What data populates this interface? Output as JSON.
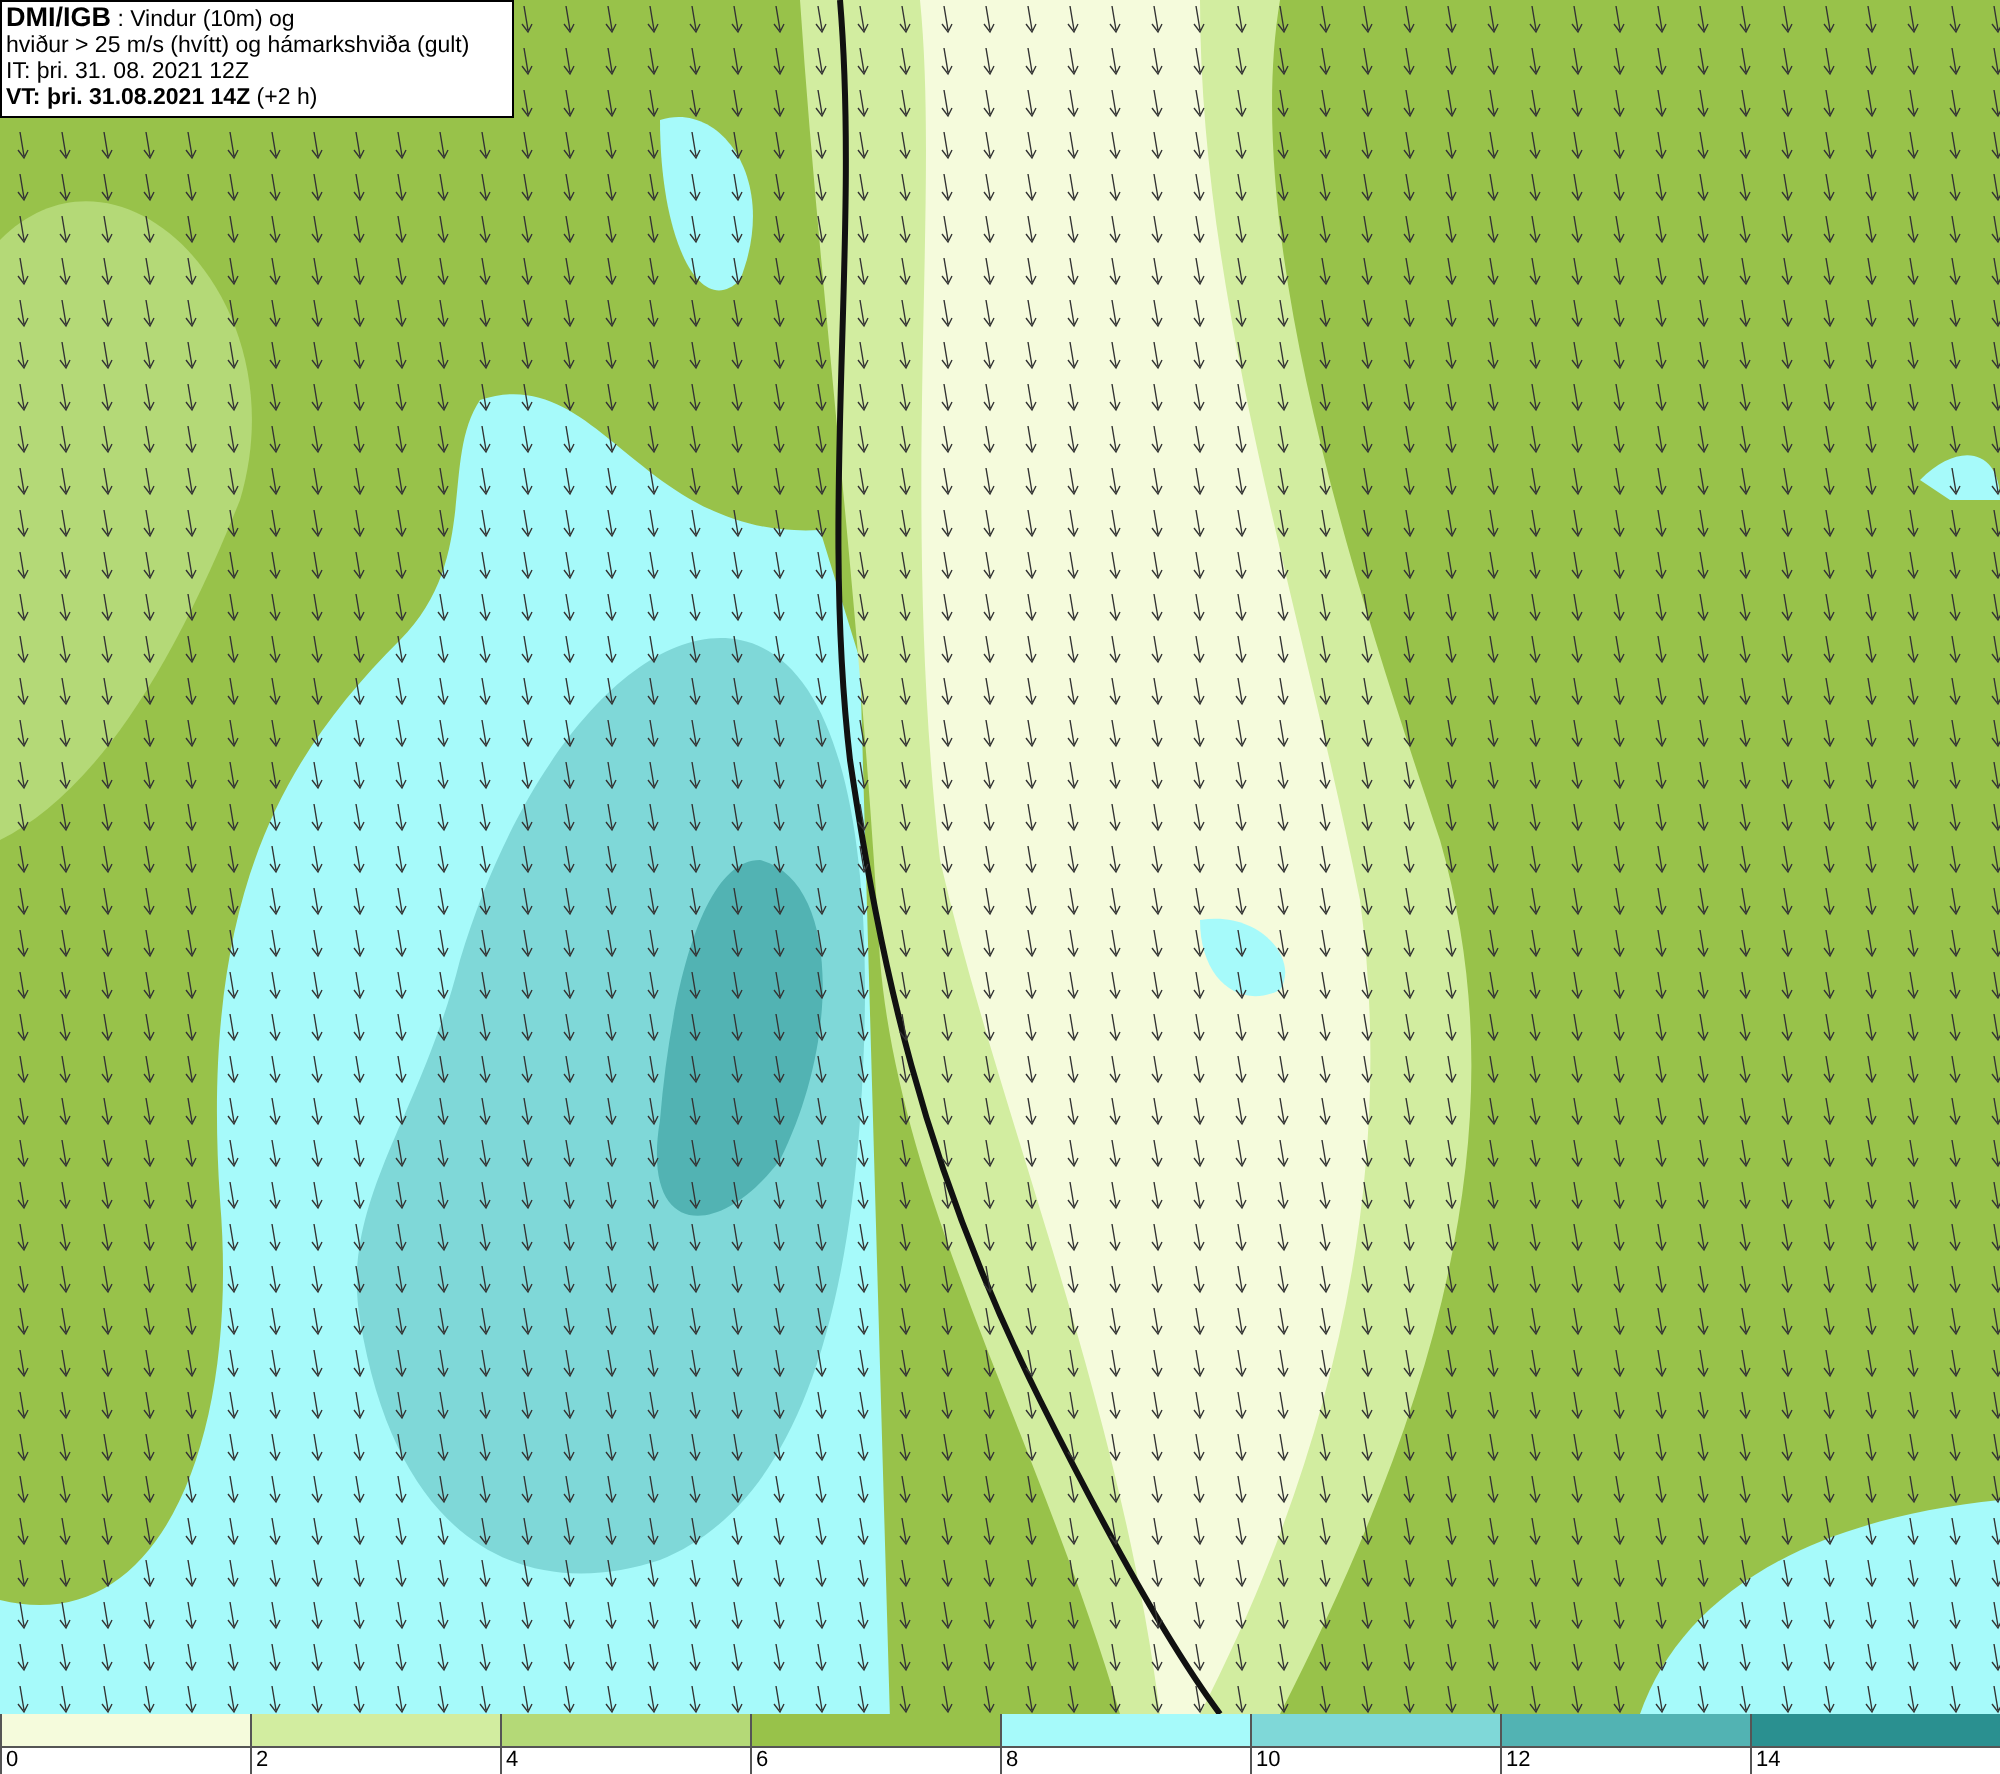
{
  "info_box": {
    "lines": [
      "**DMI/IGB** : Vindur (10m) og",
      "hviður > 25 m/s (hvítt) og hámarkshviða (gult)",
      "IT: þri. 31. 08. 2021 12Z",
      "**VT: þri. 31.08.2021 14Z** (+2 h)"
    ]
  },
  "legend": {
    "segments": [
      {
        "color": "#f5fbdc",
        "tick": "0"
      },
      {
        "color": "#d2eda0",
        "tick": "2"
      },
      {
        "color": "#b4d977",
        "tick": "4"
      },
      {
        "color": "#98c24a",
        "tick": "6"
      },
      {
        "color": "#a6fafa",
        "tick": "8"
      },
      {
        "color": "#7fd8d8",
        "tick": "10"
      },
      {
        "color": "#52b3b3",
        "tick": "12"
      },
      {
        "color": "#2a9090",
        "tick": "14"
      }
    ]
  }
}
